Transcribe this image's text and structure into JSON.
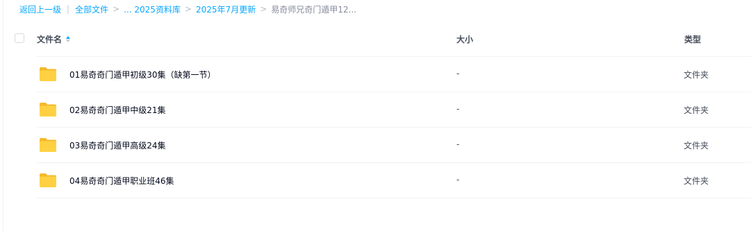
{
  "breadcrumb": {
    "back": "返回上一级",
    "separator": "|",
    "arrow": ">",
    "all_files": "全部文件",
    "ellipsis_library": "... 2025资料库",
    "month_update": "2025年7月更新",
    "current": "易奇师兄奇门遁甲12..."
  },
  "table_header": {
    "name": "文件名",
    "size": "大小",
    "type": "类型"
  },
  "rows": [
    {
      "name": "01易奇奇门遁甲初级30集（缺第一节）",
      "size": "-",
      "type": "文件夹",
      "icon": "folder-icon"
    },
    {
      "name": "02易奇奇门遁甲中级21集",
      "size": "-",
      "type": "文件夹",
      "icon": "folder-icon"
    },
    {
      "name": "03易奇奇门遁甲高级24集",
      "size": "-",
      "type": "文件夹",
      "icon": "folder-icon"
    },
    {
      "name": "04易奇奇门遁甲职业班46集",
      "size": "-",
      "type": "文件夹",
      "icon": "folder-icon"
    }
  ],
  "colors": {
    "link": "#06a7ff",
    "folder": "#ffd142",
    "folder_dark": "#f5b92a"
  }
}
